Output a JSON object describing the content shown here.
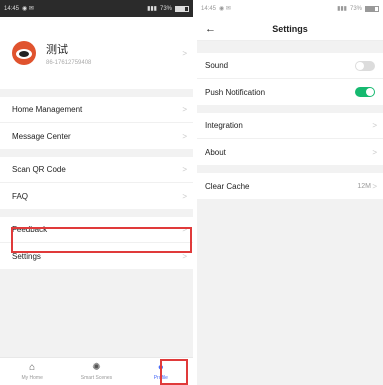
{
  "status_bar": {
    "time": "14:45",
    "battery": "73%"
  },
  "profile_screen": {
    "user": {
      "name": "测试",
      "phone": "86-17612759408"
    },
    "group1": [
      {
        "label": "Home Management"
      },
      {
        "label": "Message Center"
      }
    ],
    "group2": [
      {
        "label": "Scan QR Code"
      },
      {
        "label": "FAQ"
      }
    ],
    "group3": [
      {
        "label": "Feedback"
      },
      {
        "label": "Settings"
      }
    ],
    "tabs": [
      {
        "label": "My Home",
        "icon": "home-icon"
      },
      {
        "label": "Smart Scenes",
        "icon": "sun-icon"
      },
      {
        "label": "Profile",
        "icon": "profile-icon"
      }
    ]
  },
  "settings_screen": {
    "title": "Settings",
    "back_icon": "arrow-left-icon",
    "sound_label": "Sound",
    "sound_on": false,
    "push_label": "Push Notification",
    "push_on": true,
    "integration_label": "Integration",
    "about_label": "About",
    "clear_cache_label": "Clear Cache",
    "cache_size": "12M"
  },
  "colors": {
    "highlight": "#e03a3a",
    "toggle_on": "#16b970",
    "tab_active": "#4a6cf7",
    "avatar": "#e0532e"
  }
}
